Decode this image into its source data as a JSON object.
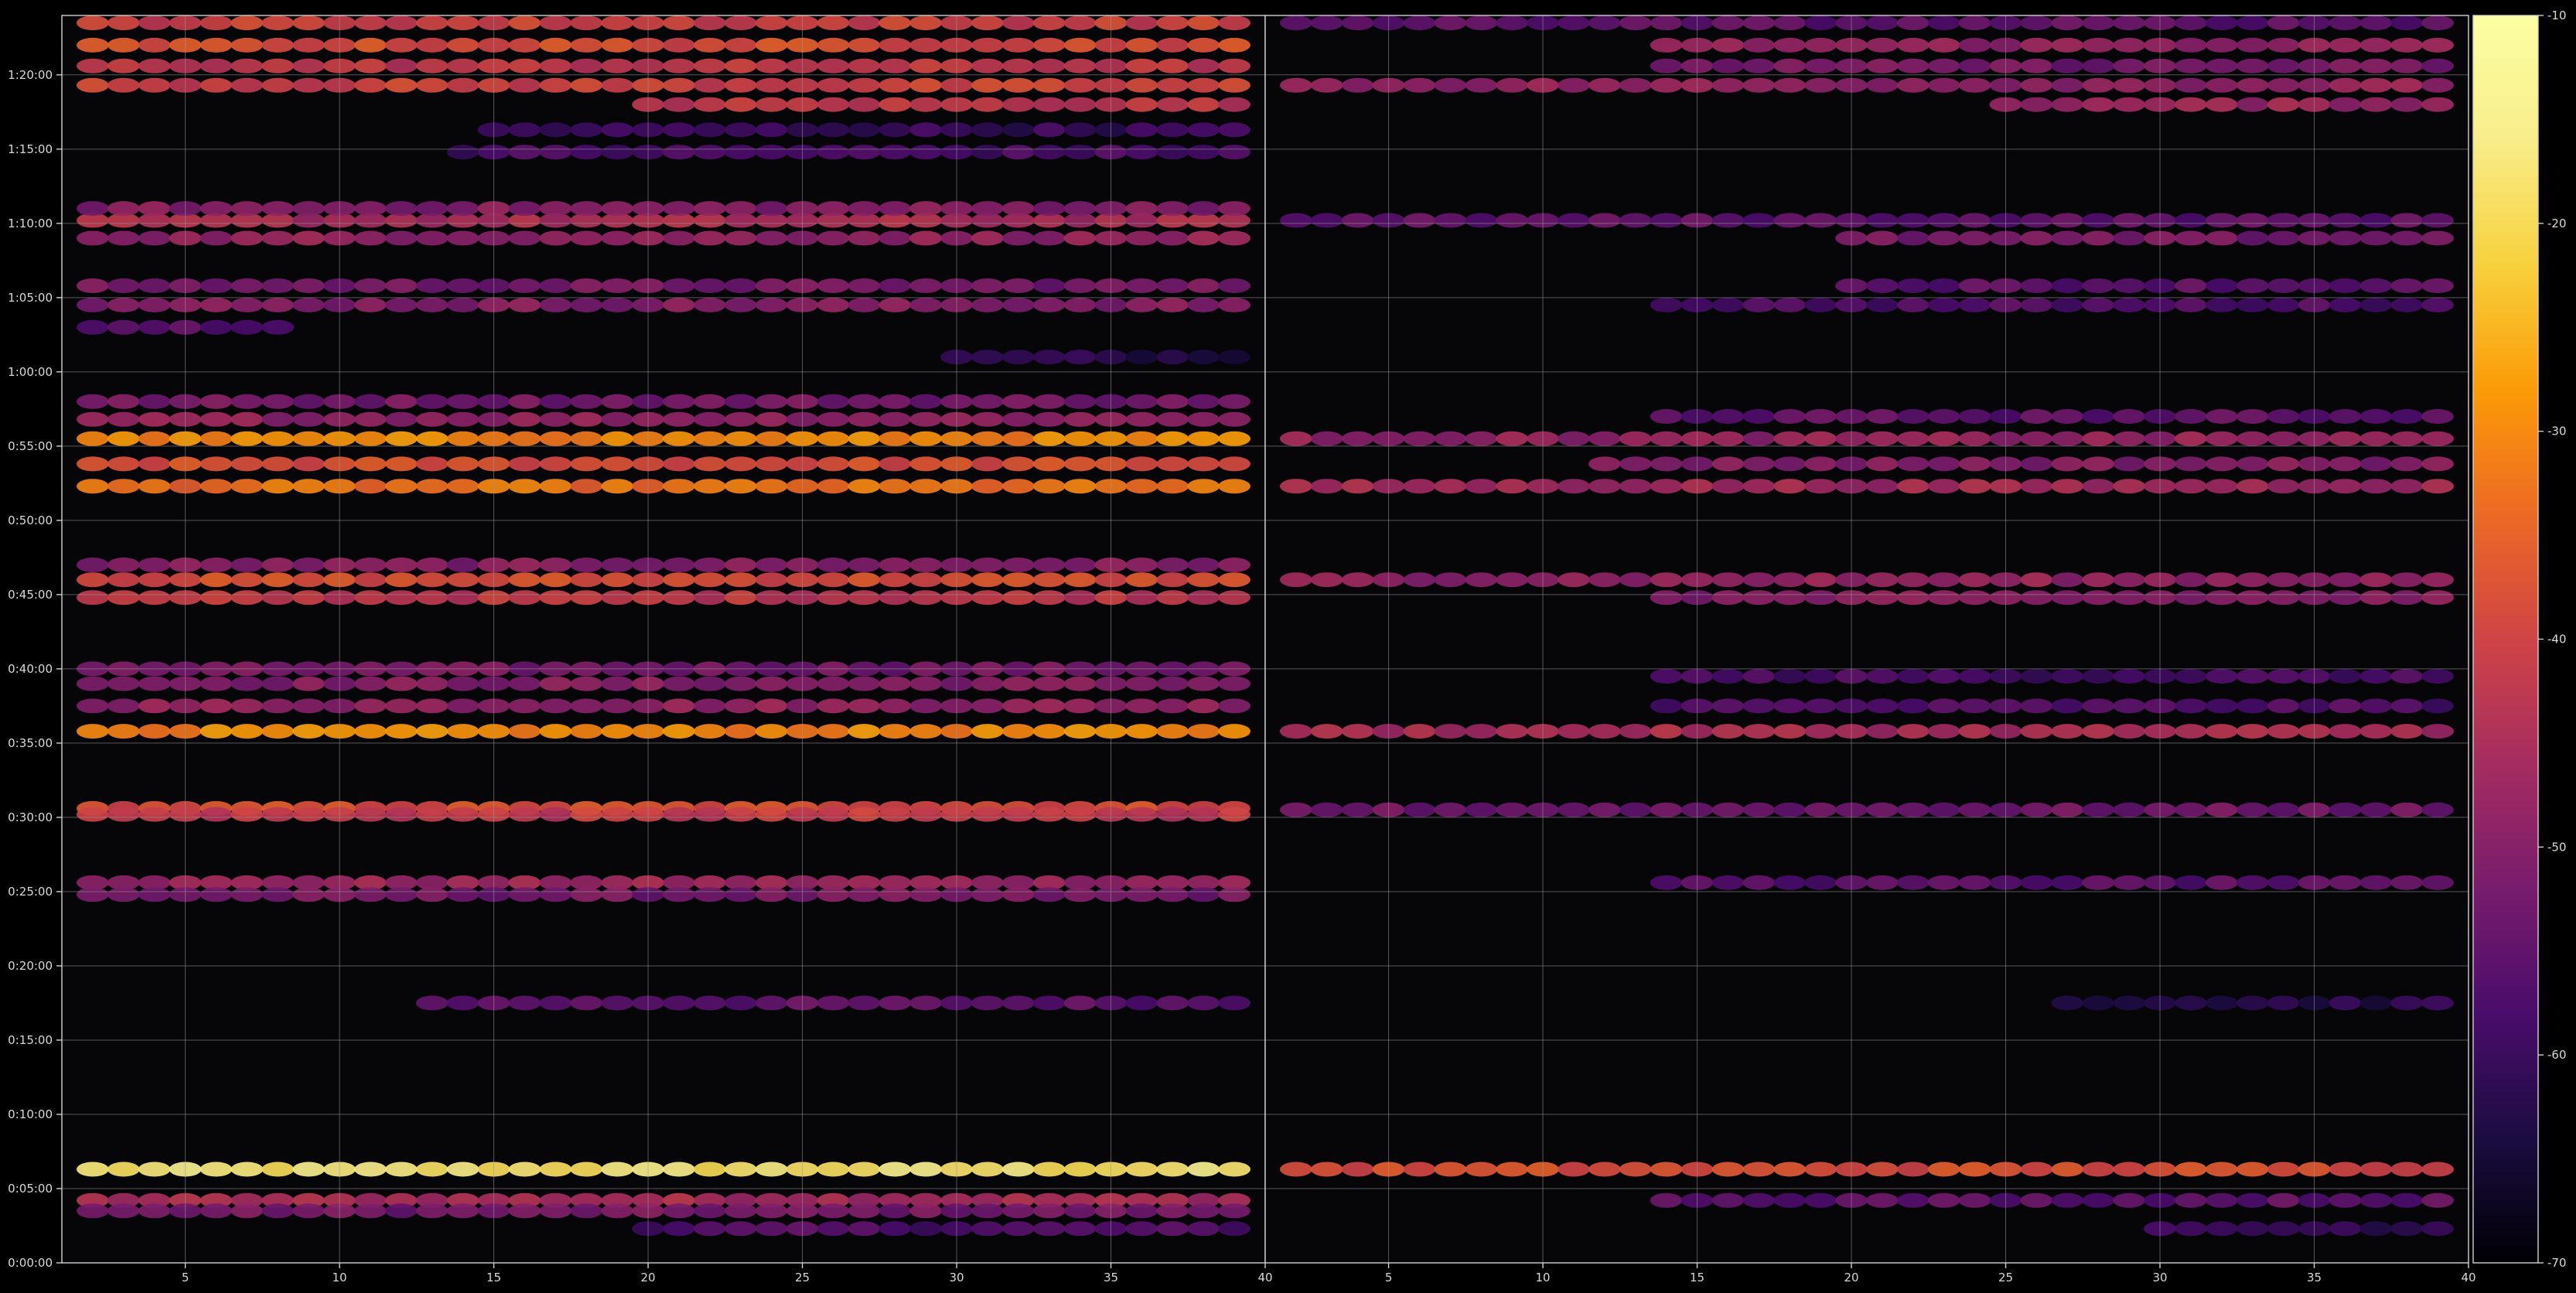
{
  "chart_data": {
    "type": "heatmap",
    "title": "",
    "xlabel": "",
    "ylabel": "",
    "grid": true,
    "colormap": "inferno",
    "colorbar": {
      "range": [
        -70,
        -10
      ],
      "ticks": [
        "-10",
        "-20",
        "-30",
        "-40",
        "-50",
        "-60",
        "-70"
      ]
    },
    "y_axis": {
      "unit": "minutes",
      "range": [
        0,
        84
      ],
      "ticks": [
        {
          "value": 0,
          "label": "0:00:00"
        },
        {
          "value": 5,
          "label": "0:05:00"
        },
        {
          "value": 10,
          "label": "0:10:00"
        },
        {
          "value": 15,
          "label": "0:15:00"
        },
        {
          "value": 20,
          "label": "0:20:00"
        },
        {
          "value": 25,
          "label": "0:25:00"
        },
        {
          "value": 30,
          "label": "0:30:00"
        },
        {
          "value": 35,
          "label": "0:35:00"
        },
        {
          "value": 40,
          "label": "0:40:00"
        },
        {
          "value": 45,
          "label": "0:45:00"
        },
        {
          "value": 50,
          "label": "0:50:00"
        },
        {
          "value": 55,
          "label": "0:55:00"
        },
        {
          "value": 60,
          "label": "1:00:00"
        },
        {
          "value": 65,
          "label": "1:05:00"
        },
        {
          "value": 70,
          "label": "1:10:00"
        },
        {
          "value": 75,
          "label": "1:15:00"
        },
        {
          "value": 80,
          "label": "1:20:00"
        }
      ]
    },
    "panels": [
      {
        "x_range": [
          1,
          40
        ],
        "x_ticks": [
          "5",
          "10",
          "15",
          "20",
          "25",
          "30",
          "35",
          "40"
        ],
        "bands": [
          {
            "y": 6.3,
            "level": -18,
            "from": 1.5,
            "to": 39.5
          },
          {
            "y": 4.2,
            "level": -45,
            "from": 1.5,
            "to": 39.5
          },
          {
            "y": 3.5,
            "level": -52,
            "from": 1.5,
            "to": 39.5
          },
          {
            "y": 2.3,
            "level": -57,
            "from": 20,
            "to": 39.5
          },
          {
            "y": 17.5,
            "level": -55,
            "from": 13,
            "to": 39.5
          },
          {
            "y": 25.6,
            "level": -47,
            "from": 1.5,
            "to": 39.5
          },
          {
            "y": 24.8,
            "level": -52,
            "from": 1.5,
            "to": 39.5
          },
          {
            "y": 30.6,
            "level": -38,
            "from": 1.5,
            "to": 39.5
          },
          {
            "y": 30.2,
            "level": -42,
            "from": 1.5,
            "to": 39.5
          },
          {
            "y": 35.8,
            "level": -30,
            "from": 1.5,
            "to": 39.5
          },
          {
            "y": 37.5,
            "level": -48,
            "from": 1.5,
            "to": 39.5
          },
          {
            "y": 39.0,
            "level": -50,
            "from": 1.5,
            "to": 39.5
          },
          {
            "y": 40.0,
            "level": -52,
            "from": 1.5,
            "to": 39.5
          },
          {
            "y": 44.8,
            "level": -42,
            "from": 1.5,
            "to": 39.5
          },
          {
            "y": 46.0,
            "level": -38,
            "from": 1.5,
            "to": 39.5
          },
          {
            "y": 47.0,
            "level": -50,
            "from": 1.5,
            "to": 39.5
          },
          {
            "y": 52.3,
            "level": -33,
            "from": 1.5,
            "to": 39.5
          },
          {
            "y": 53.8,
            "level": -38,
            "from": 1.5,
            "to": 39.5
          },
          {
            "y": 55.5,
            "level": -30,
            "from": 1.5,
            "to": 39.5
          },
          {
            "y": 56.8,
            "level": -48,
            "from": 1.5,
            "to": 39.5
          },
          {
            "y": 58.0,
            "level": -52,
            "from": 1.5,
            "to": 39.5
          },
          {
            "y": 61.0,
            "level": -62,
            "from": 30,
            "to": 39.5
          },
          {
            "y": 63.0,
            "level": -55,
            "from": 1.5,
            "to": 8
          },
          {
            "y": 64.5,
            "level": -50,
            "from": 1.5,
            "to": 39.5
          },
          {
            "y": 65.8,
            "level": -52,
            "from": 1.5,
            "to": 39.5
          },
          {
            "y": 69.0,
            "level": -48,
            "from": 1.5,
            "to": 39.5
          },
          {
            "y": 70.2,
            "level": -45,
            "from": 1.5,
            "to": 39.5
          },
          {
            "y": 71.0,
            "level": -50,
            "from": 1.5,
            "to": 39.5
          },
          {
            "y": 74.8,
            "level": -58,
            "from": 14,
            "to": 39.5
          },
          {
            "y": 76.3,
            "level": -60,
            "from": 15,
            "to": 39.5
          },
          {
            "y": 78.0,
            "level": -42,
            "from": 20,
            "to": 39.5
          },
          {
            "y": 79.3,
            "level": -40,
            "from": 1.5,
            "to": 39.5
          },
          {
            "y": 80.6,
            "level": -42,
            "from": 1.5,
            "to": 39.5
          },
          {
            "y": 82.0,
            "level": -38,
            "from": 1.5,
            "to": 39.5
          },
          {
            "y": 83.5,
            "level": -40,
            "from": 1.5,
            "to": 39.5
          }
        ]
      },
      {
        "x_range": [
          1,
          40
        ],
        "x_ticks": [
          "5",
          "10",
          "15",
          "20",
          "25",
          "30",
          "35",
          "40"
        ],
        "bands": [
          {
            "y": 6.3,
            "level": -38,
            "from": 1.5,
            "to": 39.5
          },
          {
            "y": 4.2,
            "level": -55,
            "from": 14,
            "to": 39.5
          },
          {
            "y": 2.3,
            "level": -60,
            "from": 30,
            "to": 39.5
          },
          {
            "y": 17.5,
            "level": -62,
            "from": 27,
            "to": 39.5
          },
          {
            "y": 25.6,
            "level": -56,
            "from": 14,
            "to": 39.5
          },
          {
            "y": 30.5,
            "level": -53,
            "from": 1.5,
            "to": 39.5
          },
          {
            "y": 35.8,
            "level": -45,
            "from": 1.5,
            "to": 39.5
          },
          {
            "y": 37.5,
            "level": -57,
            "from": 14,
            "to": 39.5
          },
          {
            "y": 39.5,
            "level": -58,
            "from": 14,
            "to": 39.5
          },
          {
            "y": 44.8,
            "level": -50,
            "from": 14,
            "to": 39.5
          },
          {
            "y": 46.0,
            "level": -48,
            "from": 1.5,
            "to": 39.5
          },
          {
            "y": 52.3,
            "level": -46,
            "from": 1.5,
            "to": 39.5
          },
          {
            "y": 53.8,
            "level": -50,
            "from": 12,
            "to": 39.5
          },
          {
            "y": 55.5,
            "level": -48,
            "from": 1.5,
            "to": 39.5
          },
          {
            "y": 57.0,
            "level": -55,
            "from": 14,
            "to": 39.5
          },
          {
            "y": 64.5,
            "level": -57,
            "from": 14,
            "to": 39.5
          },
          {
            "y": 65.8,
            "level": -55,
            "from": 20,
            "to": 39.5
          },
          {
            "y": 69.0,
            "level": -52,
            "from": 20,
            "to": 39.5
          },
          {
            "y": 70.2,
            "level": -55,
            "from": 1.5,
            "to": 39.5
          },
          {
            "y": 78.0,
            "level": -47,
            "from": 25,
            "to": 39.5
          },
          {
            "y": 79.3,
            "level": -48,
            "from": 1.5,
            "to": 39.5
          },
          {
            "y": 80.6,
            "level": -52,
            "from": 14,
            "to": 39.5
          },
          {
            "y": 82.0,
            "level": -48,
            "from": 14,
            "to": 39.5
          },
          {
            "y": 83.5,
            "level": -55,
            "from": 1.5,
            "to": 39.5
          }
        ]
      }
    ]
  }
}
